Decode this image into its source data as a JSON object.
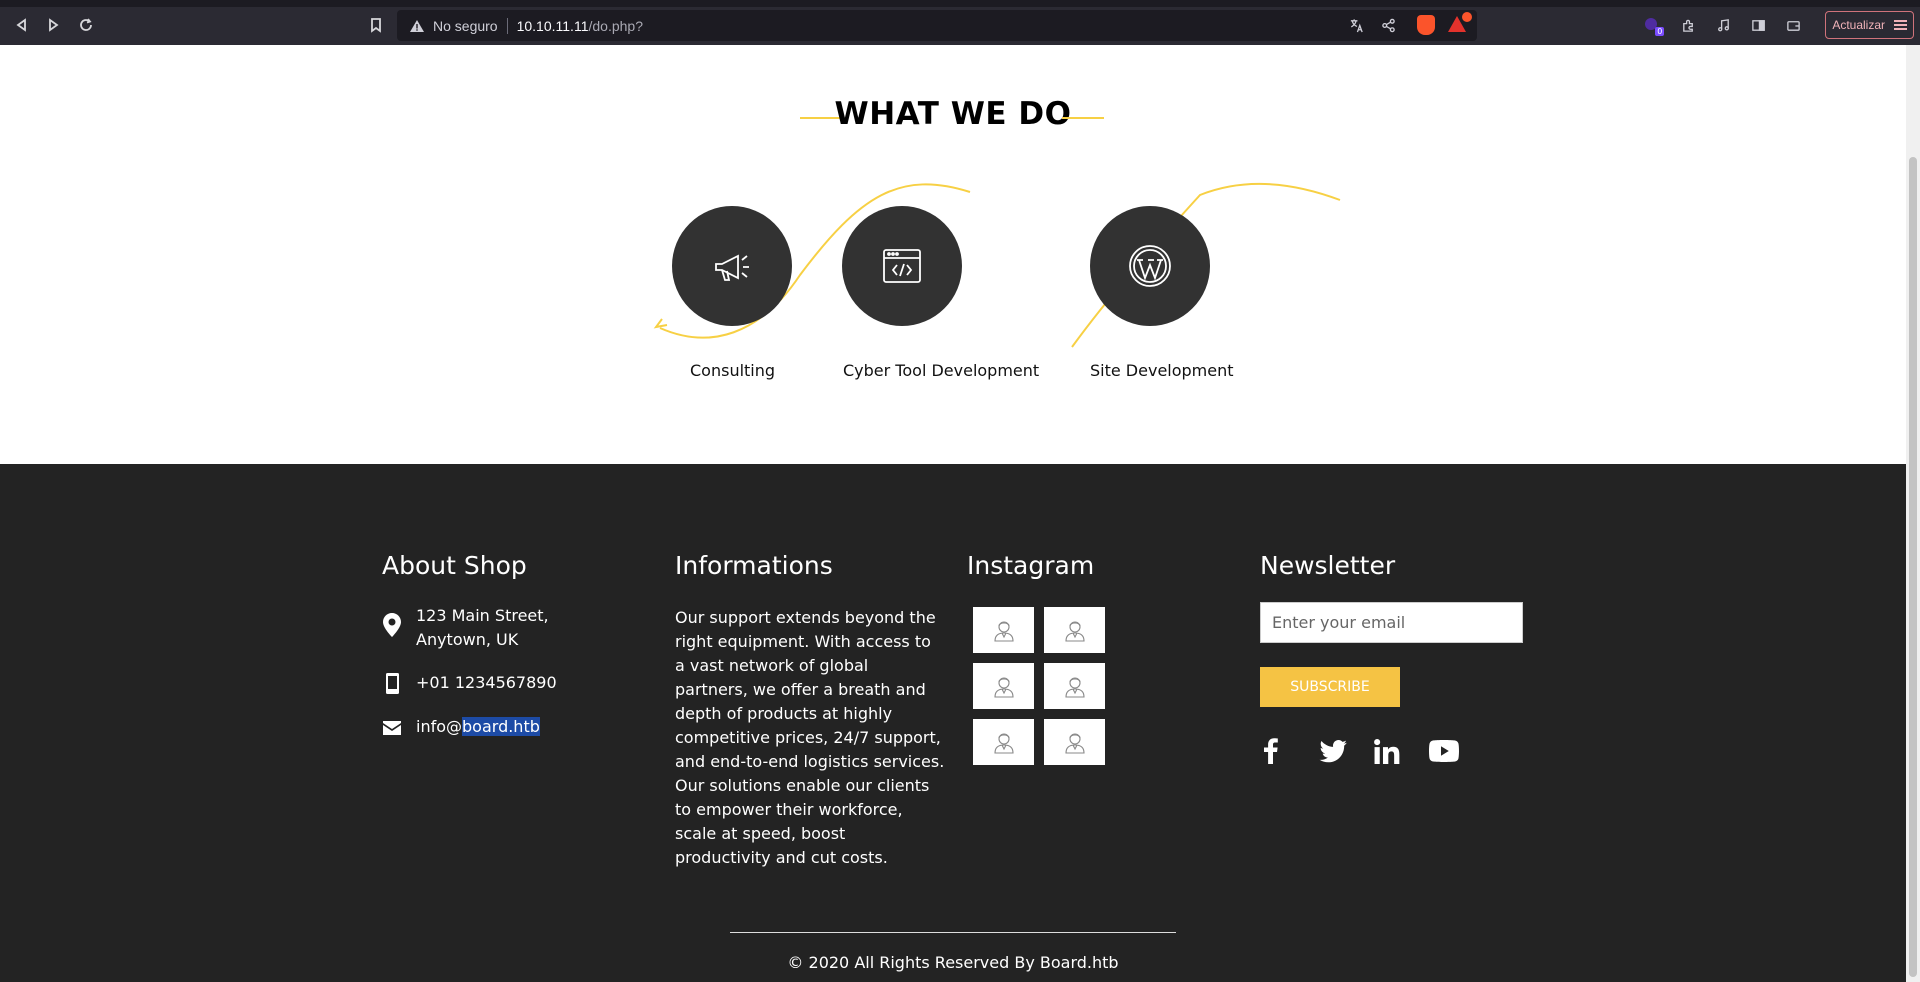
{
  "browser": {
    "back_icon": "back-arrow-icon",
    "forward_icon": "forward-arrow-icon",
    "reload_icon": "reload-icon",
    "bookmark_icon": "bookmark-icon",
    "security_label": "No seguro",
    "url_host": "10.10.11.11",
    "url_path": "/do.php?",
    "extension_badge_count": "0",
    "update_button_label": "Actualizar"
  },
  "what_we_do": {
    "title": "WHAT WE DO",
    "accent_color": "#f7d044",
    "services": [
      {
        "label": "Consulting",
        "icon": "megaphone-icon"
      },
      {
        "label": "Cyber Tool Development",
        "icon": "code-window-icon"
      },
      {
        "label": "Site Development",
        "icon": "wordpress-icon"
      }
    ]
  },
  "footer": {
    "about": {
      "title": "About Shop",
      "address_line1": "123 Main Street,",
      "address_line2": "Anytown, UK",
      "phone": "+01 1234567890",
      "email_prefix": "info@",
      "email_domain": "board.htb"
    },
    "informations": {
      "title": "Informations",
      "text": "Our support extends beyond the right equipment. With access to a vast network of global partners, we offer a breath and depth of products at highly competitive prices, 24/7 support, and end-to-end logistics services. Our solutions enable our clients to empower their workforce, scale at speed, boost productivity and cut costs."
    },
    "instagram": {
      "title": "Instagram",
      "tile_count": 6
    },
    "newsletter": {
      "title": "Newsletter",
      "placeholder": "Enter your email",
      "button_label": "SUBSCRIBE",
      "button_color": "#f5c344",
      "socials": [
        "facebook-icon",
        "twitter-icon",
        "linkedin-icon",
        "youtube-icon"
      ]
    },
    "copyright": "© 2020 All Rights Reserved By Board.htb",
    "background_color": "#232323"
  }
}
